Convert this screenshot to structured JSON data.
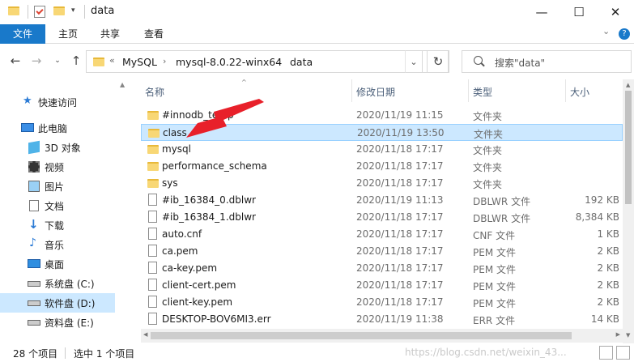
{
  "window": {
    "title": "data",
    "controls": {
      "minimize": "—",
      "maximize": "☐",
      "close": "✕"
    }
  },
  "ribbon": {
    "tabs": [
      {
        "label": "文件",
        "active": true
      },
      {
        "label": "主页",
        "active": false
      },
      {
        "label": "共享",
        "active": false
      },
      {
        "label": "查看",
        "active": false
      }
    ],
    "collapse_glyph": "⌄",
    "help_glyph": "?"
  },
  "address": {
    "overflow": "«",
    "crumbs": [
      "MySQL",
      "mysql-8.0.22-winx64",
      "data"
    ],
    "separator": "›",
    "dropdown_glyph": "⌄",
    "refresh_glyph": "↻"
  },
  "search": {
    "placeholder": "搜索\"data\""
  },
  "sidebar": {
    "items": [
      {
        "label": "快速访问",
        "icon": "star-icon"
      },
      {
        "label": "此电脑",
        "icon": "computer-icon"
      },
      {
        "label": "3D 对象",
        "icon": "cube-icon"
      },
      {
        "label": "视频",
        "icon": "video-icon"
      },
      {
        "label": "图片",
        "icon": "picture-icon"
      },
      {
        "label": "文档",
        "icon": "document-icon"
      },
      {
        "label": "下载",
        "icon": "download-icon"
      },
      {
        "label": "音乐",
        "icon": "music-icon"
      },
      {
        "label": "桌面",
        "icon": "desktop-icon"
      },
      {
        "label": "系统盘 (C:)",
        "icon": "drive-icon"
      },
      {
        "label": "软件盘 (D:)",
        "icon": "drive-icon",
        "selected": true
      },
      {
        "label": "资料盘 (E:)",
        "icon": "drive-icon"
      }
    ]
  },
  "columns": {
    "name": "名称",
    "date": "修改日期",
    "type": "类型",
    "size": "大小"
  },
  "files": [
    {
      "name": "#innodb_temp",
      "date": "2020/11/19 11:15",
      "type": "文件夹",
      "size": "",
      "kind": "folder"
    },
    {
      "name": "class",
      "date": "2020/11/19 13:50",
      "type": "文件夹",
      "size": "",
      "kind": "folder",
      "selected": true
    },
    {
      "name": "mysql",
      "date": "2020/11/18 17:17",
      "type": "文件夹",
      "size": "",
      "kind": "folder"
    },
    {
      "name": "performance_schema",
      "date": "2020/11/18 17:17",
      "type": "文件夹",
      "size": "",
      "kind": "folder"
    },
    {
      "name": "sys",
      "date": "2020/11/18 17:17",
      "type": "文件夹",
      "size": "",
      "kind": "folder"
    },
    {
      "name": "#ib_16384_0.dblwr",
      "date": "2020/11/19 11:13",
      "type": "DBLWR 文件",
      "size": "192 KB",
      "kind": "file"
    },
    {
      "name": "#ib_16384_1.dblwr",
      "date": "2020/11/18 17:17",
      "type": "DBLWR 文件",
      "size": "8,384 KB",
      "kind": "file"
    },
    {
      "name": "auto.cnf",
      "date": "2020/11/18 17:17",
      "type": "CNF 文件",
      "size": "1 KB",
      "kind": "file"
    },
    {
      "name": "ca.pem",
      "date": "2020/11/18 17:17",
      "type": "PEM 文件",
      "size": "2 KB",
      "kind": "file"
    },
    {
      "name": "ca-key.pem",
      "date": "2020/11/18 17:17",
      "type": "PEM 文件",
      "size": "2 KB",
      "kind": "file"
    },
    {
      "name": "client-cert.pem",
      "date": "2020/11/18 17:17",
      "type": "PEM 文件",
      "size": "2 KB",
      "kind": "file"
    },
    {
      "name": "client-key.pem",
      "date": "2020/11/18 17:17",
      "type": "PEM 文件",
      "size": "2 KB",
      "kind": "file"
    },
    {
      "name": "DESKTOP-BOV6MI3.err",
      "date": "2020/11/19 11:38",
      "type": "ERR 文件",
      "size": "14 KB",
      "kind": "file"
    }
  ],
  "status": {
    "count": "28 个项目",
    "selection": "选中 1 个项目",
    "watermark": "https://blog.csdn.net/weixin_43..."
  },
  "colors": {
    "accent": "#1979ca",
    "selection": "#cce8ff",
    "folder": "#f8d775",
    "annotation_arrow": "#e8202a"
  }
}
